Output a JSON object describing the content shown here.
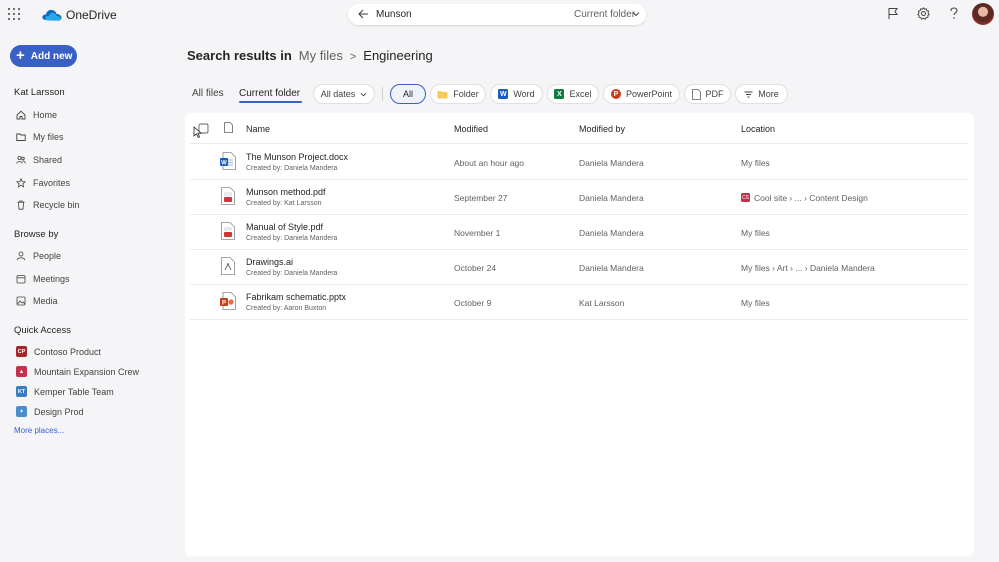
{
  "app": {
    "name": "OneDrive"
  },
  "search": {
    "query": "Munson",
    "scope": "Current folder"
  },
  "sidebar": {
    "add_new": "Add new",
    "user": "Kat Larsson",
    "nav": [
      "Home",
      "My files",
      "Shared",
      "Favorites",
      "Recycle bin"
    ],
    "browse_by_title": "Browse by",
    "browse_by": [
      "People",
      "Meetings",
      "Media"
    ],
    "quick_access_title": "Quick Access",
    "quick_access": [
      {
        "label": "Contoso Product",
        "abbr": "CP",
        "color": "#a4262c"
      },
      {
        "label": "Mountain Expansion Crew",
        "abbr": "",
        "color": "#c4314b"
      },
      {
        "label": "Kemper Table Team",
        "abbr": "KT",
        "color": "#3a7dbf"
      },
      {
        "label": "Design Prod",
        "abbr": "",
        "color": "#4a8fc9"
      }
    ],
    "more_places": "More places..."
  },
  "breadcrumb": {
    "prefix": "Search results in",
    "parent": "My files",
    "separator": ">",
    "current": "Engineering"
  },
  "tabs": {
    "all_files": "All files",
    "current_folder": "Current folder"
  },
  "filters": {
    "dates": "All dates",
    "types": [
      "All",
      "Folder",
      "Word",
      "Excel",
      "PowerPoint",
      "PDF",
      "More"
    ],
    "selected": "All"
  },
  "table": {
    "columns": [
      "Name",
      "Modified",
      "Modified by",
      "Location"
    ],
    "rows": [
      {
        "name": "The Munson Project.docx",
        "created_by": "Created by: Daniela Mandera",
        "modified": "About an hour ago",
        "modified_by": "Daniela Mandera",
        "location": "My files",
        "type": "word"
      },
      {
        "name": "Munson method.pdf",
        "created_by": "Created by: Kat Larsson",
        "modified": "September 27",
        "modified_by": "Daniela Mandera",
        "location": "Cool site › ... › Content Design",
        "type": "pdf"
      },
      {
        "name": "Manual of Style.pdf",
        "created_by": "Created by: Daniela Mandera",
        "modified": "November 1",
        "modified_by": "Daniela Mandera",
        "location": "My files",
        "type": "pdf"
      },
      {
        "name": "Drawings.ai",
        "created_by": "Created by: Daniela Mandera",
        "modified": "October 24",
        "modified_by": "Daniela Mandera",
        "location": "My files › Art › ... › Daniela Mandera",
        "type": "ai"
      },
      {
        "name": "Fabrikam schematic.pptx",
        "created_by": "Created by: Aaron Buxton",
        "modified": "October 9",
        "modified_by": "Kat Larsson",
        "location": "My files",
        "type": "pptx"
      }
    ]
  },
  "colors": {
    "accent": "#3860c5",
    "word": "#185abd",
    "excel": "#107c41",
    "powerpoint": "#c43e1c",
    "pdf": "#d13438"
  }
}
